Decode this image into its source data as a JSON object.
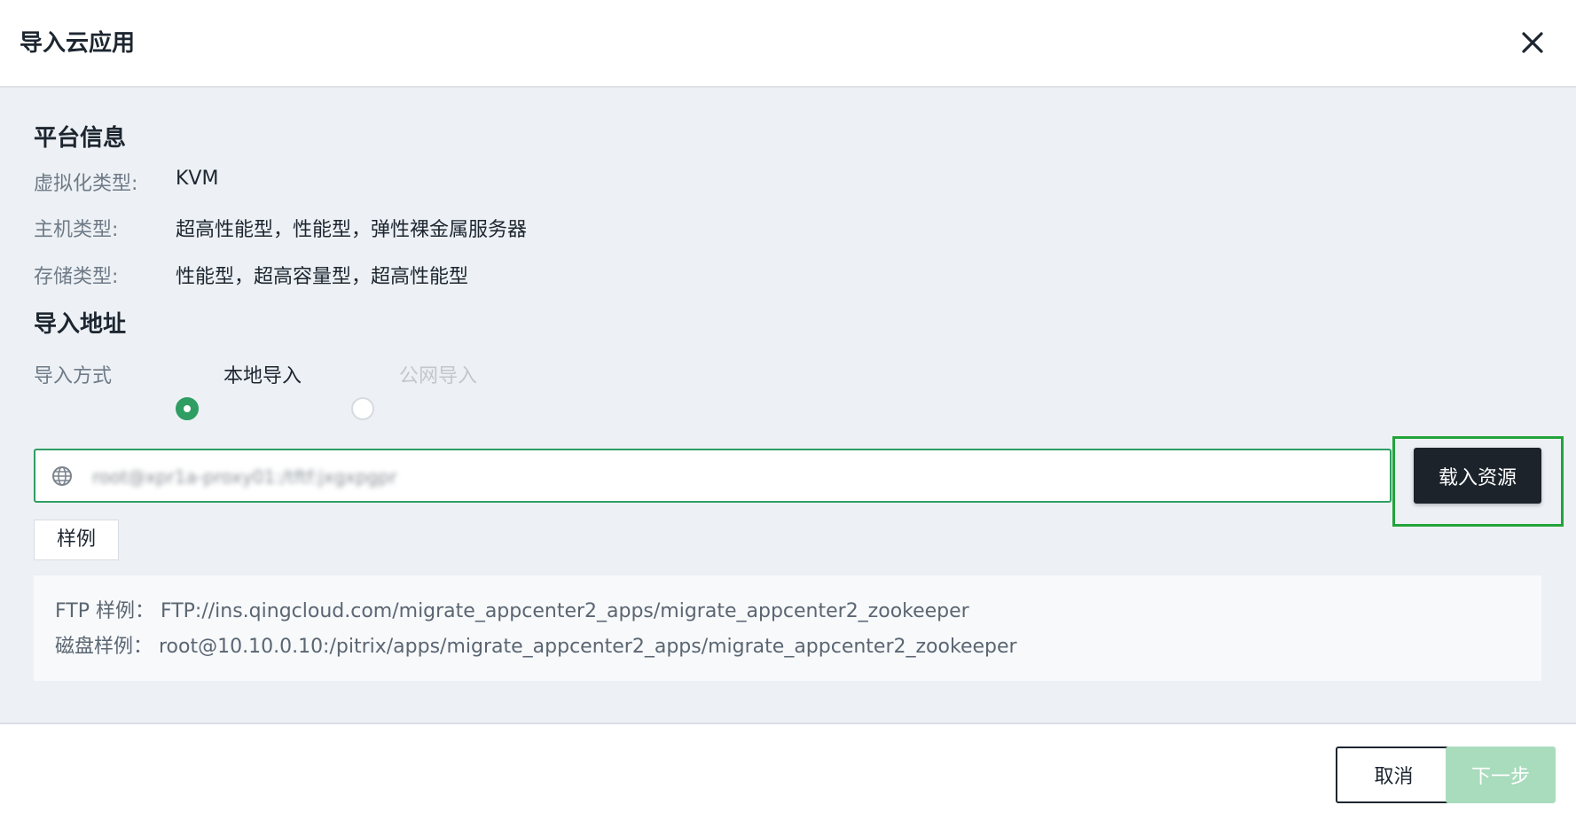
{
  "dialog": {
    "title": "导入云应用",
    "close_icon": "close-icon"
  },
  "platform_info": {
    "heading": "平台信息",
    "rows": [
      {
        "label": "虚拟化类型:",
        "value": "KVM"
      },
      {
        "label": "主机类型:",
        "value": "超高性能型，性能型，弹性裸金属服务器"
      },
      {
        "label": "存储类型:",
        "value": "性能型，超高容量型，超高性能型"
      }
    ]
  },
  "import_address": {
    "heading": "导入地址",
    "method_label": "导入方式",
    "options": [
      {
        "label": "本地导入",
        "selected": true
      },
      {
        "label": "公网导入",
        "selected": false,
        "disabled": true
      }
    ],
    "input_value": "root@xpr1a-proxy01:/tftf:jxgxpgpr",
    "input_icon": "globe-icon",
    "load_button": "载入资源",
    "example_tag": "样例",
    "examples": [
      "FTP 样例： FTP://ins.qingcloud.com/migrate_appcenter2_apps/migrate_appcenter2_zookeeper",
      "磁盘样例： root@10.10.0.10:/pitrix/apps/migrate_appcenter2_apps/migrate_appcenter2_zookeeper"
    ]
  },
  "footer": {
    "cancel": "取消",
    "next": "下一步"
  },
  "colors": {
    "accent": "#2f9e63",
    "highlight": "#22a43a",
    "primary_dark": "#1c232b",
    "disabled_next": "#a9dcbd"
  }
}
